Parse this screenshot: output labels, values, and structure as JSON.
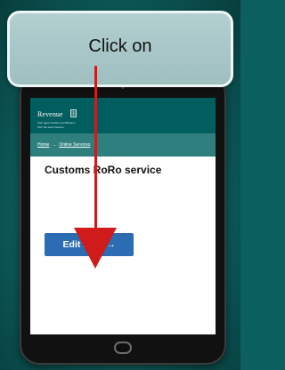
{
  "callout": {
    "text": "Click on"
  },
  "site": {
    "logo_text": "Revenue",
    "logo_sub_1": "Cáin agus Custaim na hÉireann",
    "logo_sub_2": "Irish Tax and Customs"
  },
  "breadcrumb": {
    "home": "Home",
    "separator": "→",
    "current": "Online Services"
  },
  "page": {
    "title": "Customs RoRo service",
    "button_label": "Edit PBN",
    "button_arrow": "→"
  },
  "colors": {
    "header": "#005e5e",
    "crumb_bar": "#2f7f7e",
    "button": "#2b6cb3",
    "pointer": "#d01b1b"
  }
}
